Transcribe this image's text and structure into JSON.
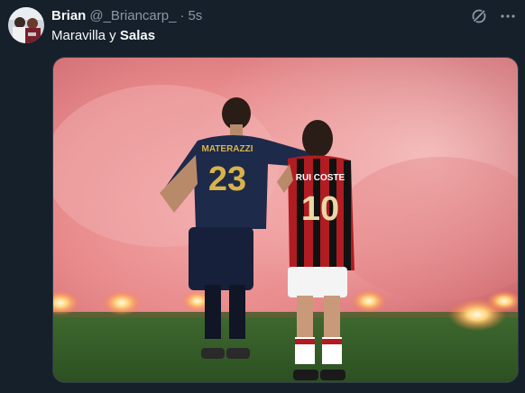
{
  "tweet": {
    "author_name": "Brian",
    "author_handle": "@_Briancarp_",
    "separator": "·",
    "timestamp": "5s",
    "text_prefix": "Maravilla y ",
    "text_bold": "Salas",
    "media": {
      "player_left": {
        "name": "MATERAZZI",
        "number": "23"
      },
      "player_right": {
        "name": "RUI COSTE",
        "number": "10"
      }
    }
  },
  "icons": {
    "grok": "grok-icon",
    "more": "more-dots-icon"
  },
  "colors": {
    "background": "#15202b",
    "secondary_text": "#8b98a5",
    "primary_text": "#f7f9f9"
  }
}
